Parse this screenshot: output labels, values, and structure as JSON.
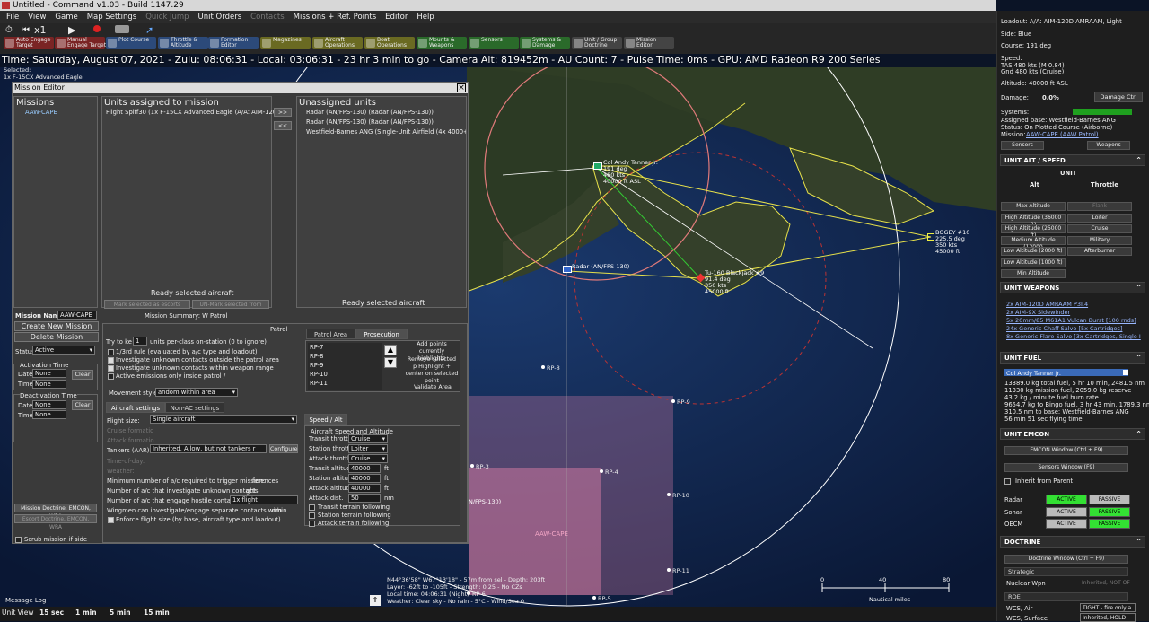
{
  "window": {
    "title": "Untitled - Command v1.03 - Build 1147.29"
  },
  "menu": [
    "File",
    "View",
    "Game",
    "Map Settings",
    "Quick Jump",
    "Unit Orders",
    "Contacts",
    "Missions + Ref. Points",
    "Editor",
    "Help"
  ],
  "menu_disabled": [
    4,
    6
  ],
  "sim": {
    "speed_label": "x1"
  },
  "toolbar": [
    {
      "label": "Auto Engage\nTarget",
      "color": "#7a2424"
    },
    {
      "label": "Manual\nEngage Target",
      "color": "#7a2424"
    },
    {
      "label": "Plot Course",
      "color": "#2c4a7a"
    },
    {
      "label": "Throttle &\nAltitude",
      "color": "#2c4a7a"
    },
    {
      "label": "Formation\nEditor",
      "color": "#2c4a7a"
    },
    {
      "label": "Magazines",
      "color": "#6a6a22"
    },
    {
      "label": "Aircraft\nOperations",
      "color": "#6a6a22"
    },
    {
      "label": "Boat\nOperations",
      "color": "#6a6a22"
    },
    {
      "label": "Mounts &\nWeapons",
      "color": "#2a6a2a"
    },
    {
      "label": "Sensors",
      "color": "#2a6a2a"
    },
    {
      "label": "Systems &\nDamage",
      "color": "#2a6a2a"
    },
    {
      "label": "Unit / Group\nDoctrine",
      "color": "#444"
    },
    {
      "label": "Mission\nEditor",
      "color": "#444"
    }
  ],
  "timebar": "Time: Saturday, August 07, 2021 - Zulu: 08:06:31 - Local: 03:06:31 - 23 hr 3 min to go -  Camera Alt: 819452m  - AU Count: 7 - Pulse Time: 0ms - GPU: AMD Radeon R9 200 Series",
  "selected": {
    "label": "Selected:",
    "unit": "1x F-15CX Advanced Eagle"
  },
  "map": {
    "units": [
      {
        "name": "Col Andy Tanner Jr.",
        "lines": [
          "191 deg",
          "480 kts",
          "40000 ft ASL"
        ]
      },
      {
        "name": "BOGEY #10",
        "lines": [
          "225.5 deg",
          "350 kts",
          "45000 ft"
        ]
      },
      {
        "name": "Tu-160 Blackjack #9",
        "lines": [
          "91.4 deg",
          "350 kts",
          "45000 ft"
        ]
      },
      {
        "name": "Radar (AN/FPS-130)",
        "lines": []
      },
      {
        "name": "N/FPS-130)",
        "lines": []
      }
    ],
    "ref_points": [
      "RP-8",
      "RP-9",
      "RP-3",
      "RP-4",
      "RP-10",
      "RP-6",
      "RP-11",
      "RP-5"
    ],
    "mission_area": "AAW-CAPE",
    "cursor_info": [
      "N44°36'58\"  W67°13'18\" - 57m from sel - Depth: 203ft",
      "Layer: -62ft to -105ft - Strength: 0.25 - No CZs",
      "Local time: 04:06:31 (Night)",
      "Weather: Clear sky - No rain - 5°C - Wind/Sea 0"
    ],
    "scale_ticks": [
      "0",
      "40",
      "80"
    ],
    "scale_label": "Nautical miles"
  },
  "mission_editor": {
    "title": "Mission Editor",
    "missions_hdr": "Missions",
    "missions": [
      "AAW-CAPE"
    ],
    "assigned_hdr": "Units assigned to mission",
    "assigned": [
      "Flight Spiff30 (1x F-15CX Advanced Eagle (A/A: AIM-120D ..."
    ],
    "unassigned_hdr": "Unassigned units",
    "unassigned": [
      "Radar (AN/FPS-130) (Radar (AN/FPS-130))",
      "Radar (AN/FPS-130) (Radar (AN/FPS-130))",
      "Westfield-Barnes ANG (Single-Unit Airfield (4x 4000+ Run"
    ],
    "move_right": ">>",
    "move_left": "<<",
    "ready_assigned": "Ready selected aircraft",
    "mark_escorts": "Mark selected as escorts",
    "unmark_escorts": "UN-Mark selected from escorts",
    "ready_unassigned": "Ready selected aircraft",
    "mission_name_lbl": "Mission Name:",
    "mission_name": "AAW-CAPE",
    "summary": "Mission Summary: W Patrol",
    "create": "Create New Mission",
    "delete": "Delete Mission",
    "status_lbl": "Status:",
    "status": "Active",
    "activation_lbl": "Activation Time",
    "deactivation_lbl": "Deactivation Time",
    "date_lbl": "Date",
    "time_lbl": "Time",
    "none": "None",
    "clear": "Clear",
    "doctrine_btn": "Mission Doctrine, EMCON, WRA",
    "escort_doc": "Escort Doctrine, EMCON, WRA",
    "scrub": "Scrub mission if side",
    "patrol_hdr": "Patrol",
    "try_keep_pre": "Try to ke",
    "try_keep_val": "1",
    "try_keep_post": "units per-class on-station (0 to ignore)",
    "opts": [
      {
        "label": "1/3rd rule (evaluated by a/c type and loadout)",
        "on": false
      },
      {
        "label": "Investigate unknown contacts outside the patrol area",
        "on": true
      },
      {
        "label": "Investigate unknown contacts within weapon range",
        "on": true
      },
      {
        "label": "Active emissions only inside patrol /",
        "on": false
      }
    ],
    "move_style_lbl": "Movement style:",
    "move_style": "andom within area",
    "tab_patrol": "Patrol Area",
    "tab_prosecution": "Prosecution Area",
    "rps": [
      "RP-7",
      "RP-8",
      "RP-9",
      "RP-10",
      "RP-11"
    ],
    "add_points": "Add points currently highlighte",
    "remove_points": "Remove selected p Highlight + center on selected point",
    "validate": "Validate Area",
    "tab_aircraft": "Aircraft settings",
    "tab_nonac": "Non-AC settings",
    "flight_size_lbl": "Flight size:",
    "flight_size": "Single aircraft",
    "cruise_form": "Cruise formatio",
    "attack_form": "Attack formatio",
    "tankers_lbl": "Tankers (AAR):",
    "tankers": "Inherited, Allow, but not tankers r",
    "configure": "Configure",
    "tod_lbl": "Time-of-day:",
    "weather_lbl": "Weather:",
    "min_trigger": "Minimum number of a/c required to trigger mission:",
    "min_trigger_val": "ferences",
    "num_unknown": "Number of a/c that investigate unknown contacts:",
    "num_unknown_val": "ght",
    "num_hostile": "Number of a/c that engage hostile contacts:",
    "num_hostile_val": "1x flight",
    "wingmen": "Wingmen can investigate/engage separate contacts within",
    "wingmen_unit": "nm",
    "enforce": "Enforce flight size (by base, aircraft type and loadout)",
    "speed_tab": "Speed / Alt",
    "speed_hdr": "Aircraft Speed and Altitude",
    "transit_thr": "Transit throttle",
    "transit_thr_v": "Cruise",
    "station_thr": "Station throttle",
    "station_thr_v": "Loiter",
    "attack_thr": "Attack throttle",
    "attack_thr_v": "Cruise",
    "transit_alt": "Transit altitude",
    "transit_alt_v": "40000",
    "station_alt": "Station altitude",
    "station_alt_v": "40000",
    "attack_alt": "Attack altitude",
    "attack_alt_v": "40000",
    "attack_dist": "Attack dist.",
    "attack_dist_v": "50",
    "ft": "ft",
    "nm": "nm",
    "terrain": [
      "Transit terrain following",
      "Station terrain following",
      "Attack terrain following"
    ]
  },
  "right_panel": {
    "loadout": "Loadout: A/A: AIM-120D AMRAAM, Light",
    "side": "Side: Blue",
    "course": "Course: 191 deg",
    "speed": "Speed:",
    "tas": "TAS 480 kts (M 0.84)",
    "gnd": "Gnd 480 kts (Cruise)",
    "altitude": "Altitude: 40000 ft ASL",
    "damage_lbl": "Damage:",
    "damage": "0.0%",
    "damage_ctrl": "Damage Ctrl",
    "systems": "Systems:",
    "base": "Assigned base: Westfield-Barnes ANG",
    "status": "Status: On Plotted Course (Airborne)",
    "mission_lbl": "Mission:",
    "mission": "AAW-CAPE (AAW Patrol)",
    "sensors": "Sensors",
    "weapons": "Weapons",
    "altspeed_hdr": "UNIT ALT / SPEED",
    "unit": "UNIT",
    "alt": "Alt",
    "throttle": "Throttle",
    "alt_btns": [
      "Max Altitude",
      "High Altitude (36000 ft)",
      "High Altitude (25000 ft)",
      "Medium Altitude (12000",
      "Low Altitude (2000 ft)",
      "Low Altitude (1000 ft)",
      "Min Altitude"
    ],
    "thr_btns": [
      "Flank",
      "Loiter",
      "Cruise",
      "Military",
      "Afterburner"
    ],
    "weapons_hdr": "UNIT WEAPONS",
    "weapons_list": [
      "2x AIM-120D AMRAAM P3I.4",
      "2x AIM-9X Sidewinder",
      "5x 20mm/85 M61A1 Vulcan Burst [100 rnds]",
      "24x Generic Chaff Salvo [5x Cartridges]",
      "8x Generic Flare Salvo [3x Cartridges, Single I"
    ],
    "fuel_hdr": "UNIT FUEL",
    "fuel_unit": "Col Andy Tanner Jr.",
    "fuel_lines": [
      "13389.0 kg total fuel, 5 hr 10 min, 2481.5 nm",
      "11330 kg mission fuel, 2059.0 kg reserve",
      "43.2 kg / minute fuel burn rate",
      "9654.7 kg to Bingo fuel, 3 hr 43 min, 1789.3 nm",
      "310.5 nm to base: Westfield-Barnes ANG",
      "56 min 51 sec flying time"
    ],
    "emcon_hdr": "UNIT EMCON",
    "emcon_window": "EMCON Window (Ctrl + F9)",
    "sensors_window": "Sensors Window (F9)",
    "inherit": "Inherit from Parent",
    "radar": "Radar",
    "sonar": "Sonar",
    "oecm": "OECM",
    "active": "ACTIVE",
    "passive": "PASSIVE",
    "doctrine_hdr": "DOCTRINE",
    "doctrine_window": "Doctrine Window (Ctrl + F9)",
    "strategic": "Strategic",
    "nuclear": "Nuclear Wpn",
    "nuclear_v": "Inherited, NOT OF",
    "roe": "ROE",
    "wcs_air": "WCS, Air",
    "wcs_air_v": "TIGHT - fire only a",
    "wcs_surf": "WCS, Surface",
    "wcs_surf_v": "Inherited, HOLD -"
  },
  "bottom": {
    "unitview": "Unit View",
    "steps": [
      "15 sec",
      "1 min",
      "5 min",
      "15 min"
    ],
    "msglog": "Message Log"
  },
  "colors": {
    "active_green": "#33e033",
    "systems_bar": "#1fa01f",
    "link_blue": "#9ab8ff"
  }
}
